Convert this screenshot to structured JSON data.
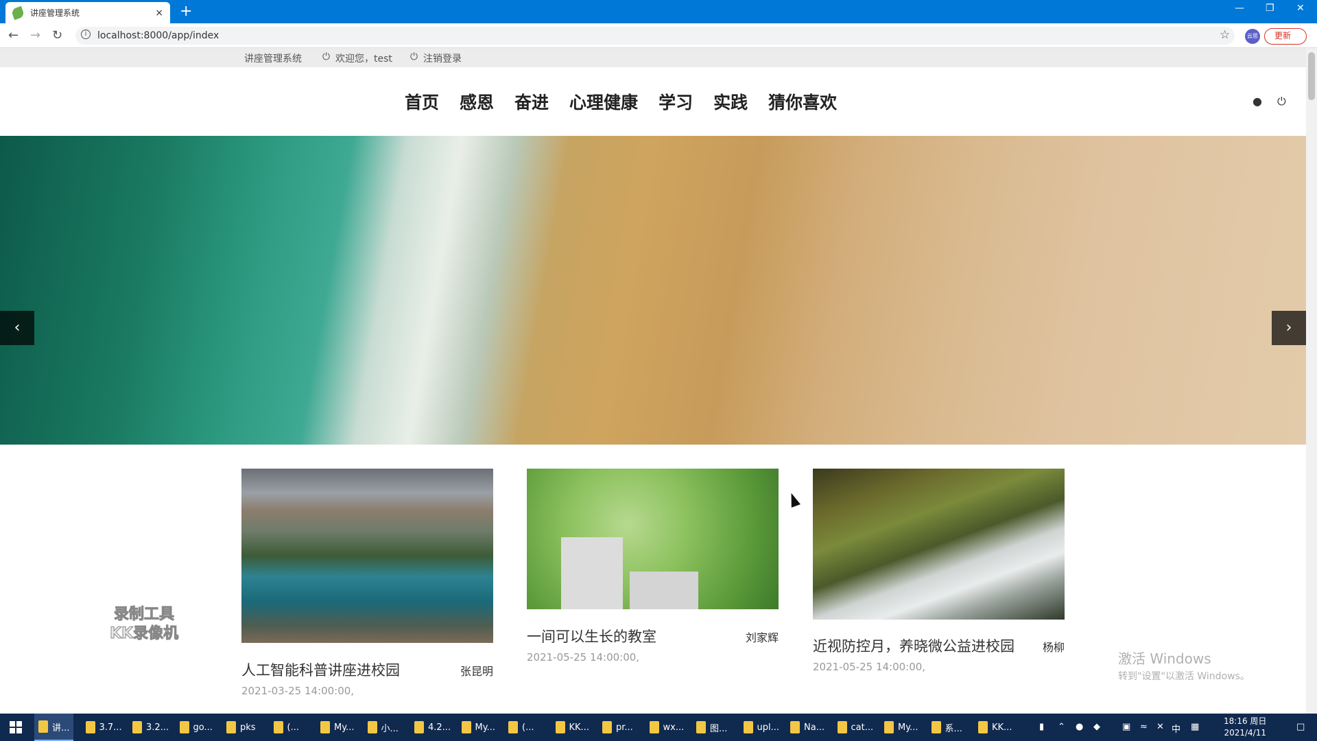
{
  "browser": {
    "tab_title": "讲座管理系统",
    "tab_close": "×",
    "new_tab": "+",
    "url": "localhost:8000/app/index",
    "update_label": "更新",
    "profile_label": "云思"
  },
  "topstrip": {
    "site_name": "讲座管理系统",
    "welcome": "欢迎您，test",
    "logout": "注销登录"
  },
  "nav": {
    "items": [
      "首页",
      "感恩",
      "奋进",
      "心理健康",
      "学习",
      "实践",
      "猜你喜欢"
    ]
  },
  "banner": {
    "prev": "‹",
    "next": "›"
  },
  "cards": [
    {
      "title": "人工智能科普讲座进校园",
      "author": "张昆明",
      "date": "2021-03-25 14:00:00,"
    },
    {
      "title": "一间可以生长的教室",
      "author": "刘家辉",
      "date": "2021-05-25 14:00:00,"
    },
    {
      "title": "近视防控月，养晓微公益进校园",
      "author": "杨柳",
      "date": "2021-05-25 14:00:00,"
    }
  ],
  "watermark": {
    "line1": "录制工具",
    "line2": "KK录像机"
  },
  "activation": {
    "line1": "激活 Windows",
    "line2": "转到\"设置\"以激活 Windows。"
  },
  "taskbar": {
    "items": [
      "讲...",
      "3.7...",
      "3.2...",
      "go...",
      "pks",
      "(...",
      "My...",
      "小...",
      "4.2...",
      "My...",
      "(...",
      "KK...",
      "pr...",
      "wx...",
      "图...",
      "upl...",
      "Na...",
      "cat...",
      "My...",
      "系...",
      "KK..."
    ],
    "ime": "中",
    "time": "18:16 周日",
    "date": "2021/4/11"
  }
}
